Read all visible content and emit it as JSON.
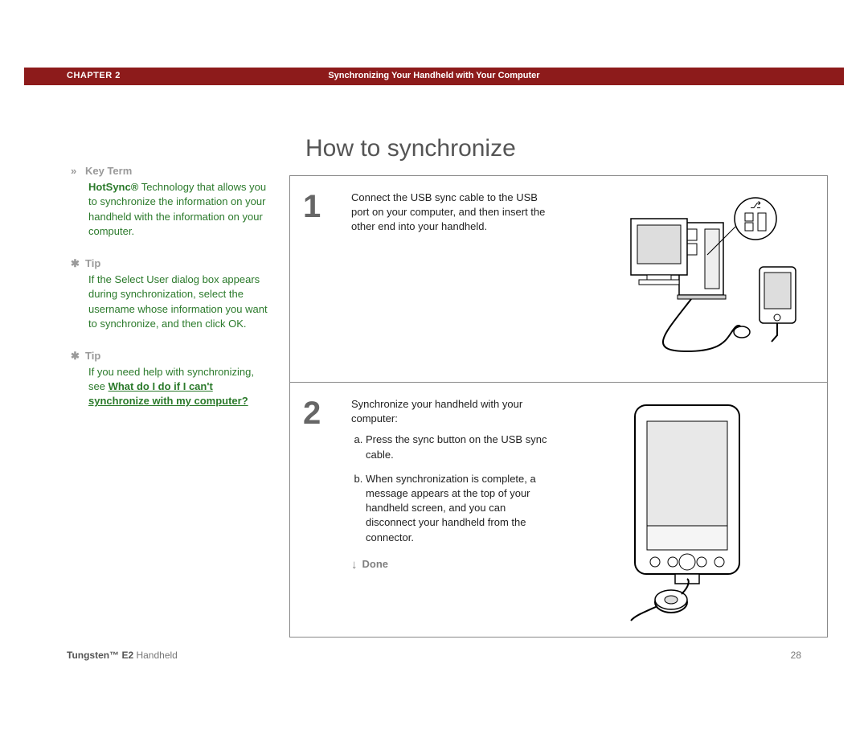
{
  "header": {
    "chapter": "CHAPTER 2",
    "title": "Synchronizing Your Handheld with Your Computer"
  },
  "page_title": "How to synchronize",
  "sidebar": {
    "keyterm": {
      "label": "Key Term",
      "term": "HotSync®",
      "text": "  Technology that allows you to synchronize the information on your handheld with the information on your computer."
    },
    "tip1": {
      "label": "Tip",
      "text": "If the Select User dialog box appears during synchronization, select the username whose information you want to synchronize, and then click OK."
    },
    "tip2": {
      "label": "Tip",
      "lead": "If you need help with synchronizing, see ",
      "link": "What do I do if I can't synchronize with my computer?"
    }
  },
  "steps": [
    {
      "num": "1",
      "text": "Connect the USB sync cable to the USB port on your computer, and then insert the other end into your handheld."
    },
    {
      "num": "2",
      "intro": "Synchronize your handheld with your computer:",
      "a": "Press the sync button on the USB sync cable.",
      "b": "When synchronization is complete, a message appears at the top of your handheld screen, and you can disconnect your handheld from the connector."
    }
  ],
  "done_label": "Done",
  "footer": {
    "product_bold": "Tungsten™ E2",
    "product_rest": "  Handheld",
    "page": "28"
  }
}
